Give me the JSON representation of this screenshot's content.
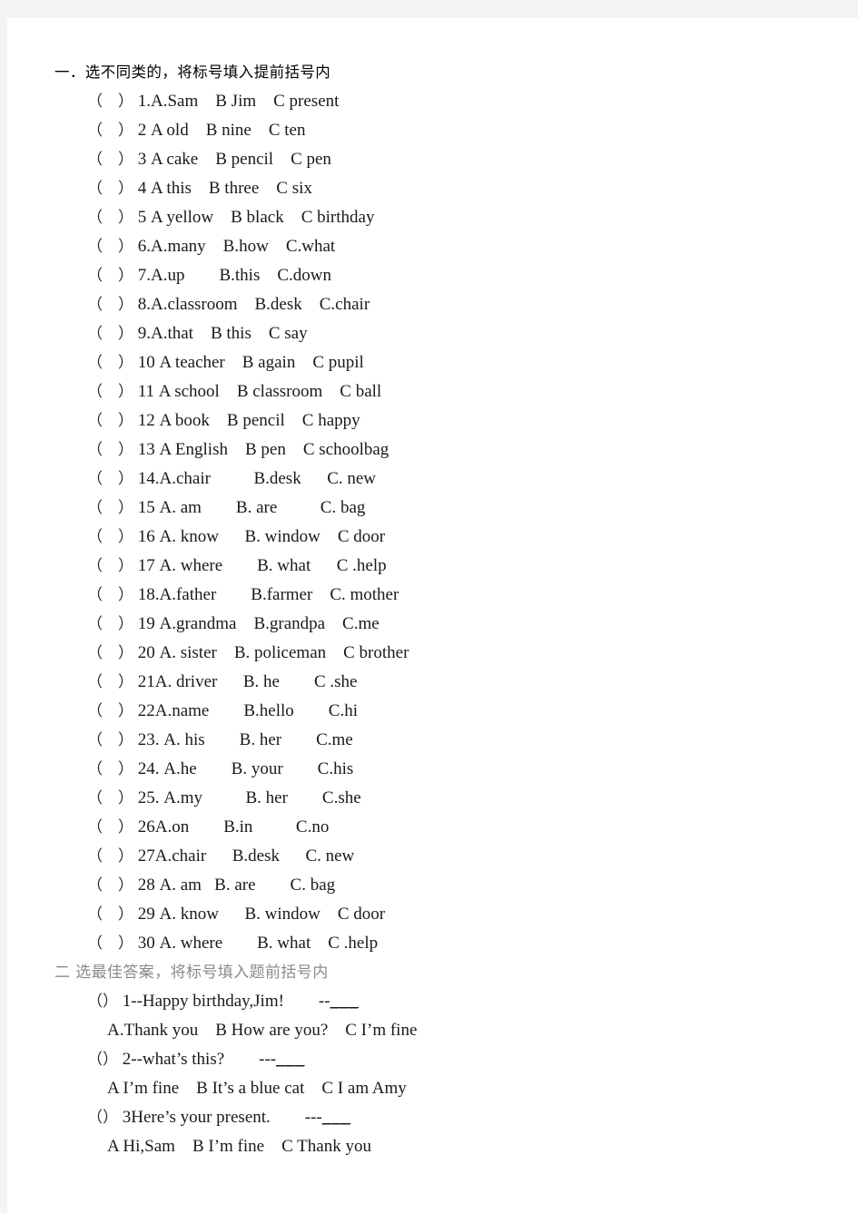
{
  "page": {
    "background_color": "#f4f4f4",
    "paper_color": "#ffffff"
  },
  "sections": [
    {
      "id": "section-one",
      "heading": "一．选不同类的，将标号填入提前括号内",
      "heading_color": "#000000",
      "bracket_open": "（",
      "bracket_close": "）",
      "questions": [
        {
          "number": "1.",
          "text": "1.A.Sam    B Jim    C present"
        },
        {
          "number": "2",
          "text": "2 A old    B nine    C ten"
        },
        {
          "number": "3",
          "text": "3 A cake    B pencil    C pen"
        },
        {
          "number": "4",
          "text": "4 A this    B three    C six"
        },
        {
          "number": "5",
          "text": "5 A yellow    B black    C birthday"
        },
        {
          "number": "6.",
          "text": "6.A.many    B.how    C.what"
        },
        {
          "number": "7.",
          "text": "7.A.up        B.this    C.down"
        },
        {
          "number": "8.",
          "text": "8.A.classroom    B.desk    C.chair"
        },
        {
          "number": "9.",
          "text": "9.A.that    B this    C say"
        },
        {
          "number": "10",
          "text": "10 A teacher    B again    C pupil"
        },
        {
          "number": "11",
          "text": "11 A school    B classroom    C ball"
        },
        {
          "number": "12",
          "text": "12 A book    B pencil    C happy"
        },
        {
          "number": "13",
          "text": "13 A English    B pen    C schoolbag"
        },
        {
          "number": "14.",
          "text": "14.A.chair          B.desk      C. new"
        },
        {
          "number": "15",
          "text": "15 A. am        B. are          C. bag"
        },
        {
          "number": "16",
          "text": "16 A. know      B. window    C door"
        },
        {
          "number": "17",
          "text": "17 A. where        B. what      C .help"
        },
        {
          "number": "18.",
          "text": "18.A.father        B.farmer    C. mother"
        },
        {
          "number": "19",
          "text": "19 A.grandma    B.grandpa    C.me"
        },
        {
          "number": "20",
          "text": "20 A. sister    B. policeman    C brother"
        },
        {
          "number": "21",
          "text": "21A. driver      B. he        C .she"
        },
        {
          "number": "22",
          "text": "22A.name        B.hello        C.hi"
        },
        {
          "number": "23.",
          "text": "23. A. his        B. her        C.me"
        },
        {
          "number": "24.",
          "text": "24. A.he        B. your        C.his"
        },
        {
          "number": "25.",
          "text": "25. A.my          B. her        C.she"
        },
        {
          "number": "26",
          "text": "26A.on        B.in          C.no"
        },
        {
          "number": "27",
          "text": "27A.chair      B.desk      C. new"
        },
        {
          "number": "28",
          "text": "28 A. am   B. are        C. bag"
        },
        {
          "number": "29",
          "text": "29 A. know      B. window    C door"
        },
        {
          "number": "30",
          "text": "30 A. where        B. what    C .help"
        }
      ]
    },
    {
      "id": "section-two",
      "heading": "二 选最佳答案，将标号填入题前括号内",
      "heading_color": "#8a8a8a",
      "bracket_open": "（",
      "bracket_close": "）",
      "items": [
        {
          "stem": "1--Happy birthday,Jim!        --",
          "blank": "___",
          "options": "A.Thank you    B How are you?    C I’m fine"
        },
        {
          "stem": "2--what’s this?        ---",
          "blank": "___",
          "options": "A I’m fine    B It’s a blue cat    C I am Amy"
        },
        {
          "stem": "3Here’s your present.        ---",
          "blank": "___",
          "options": "A Hi,Sam    B I’m fine    C Thank you"
        }
      ]
    }
  ]
}
